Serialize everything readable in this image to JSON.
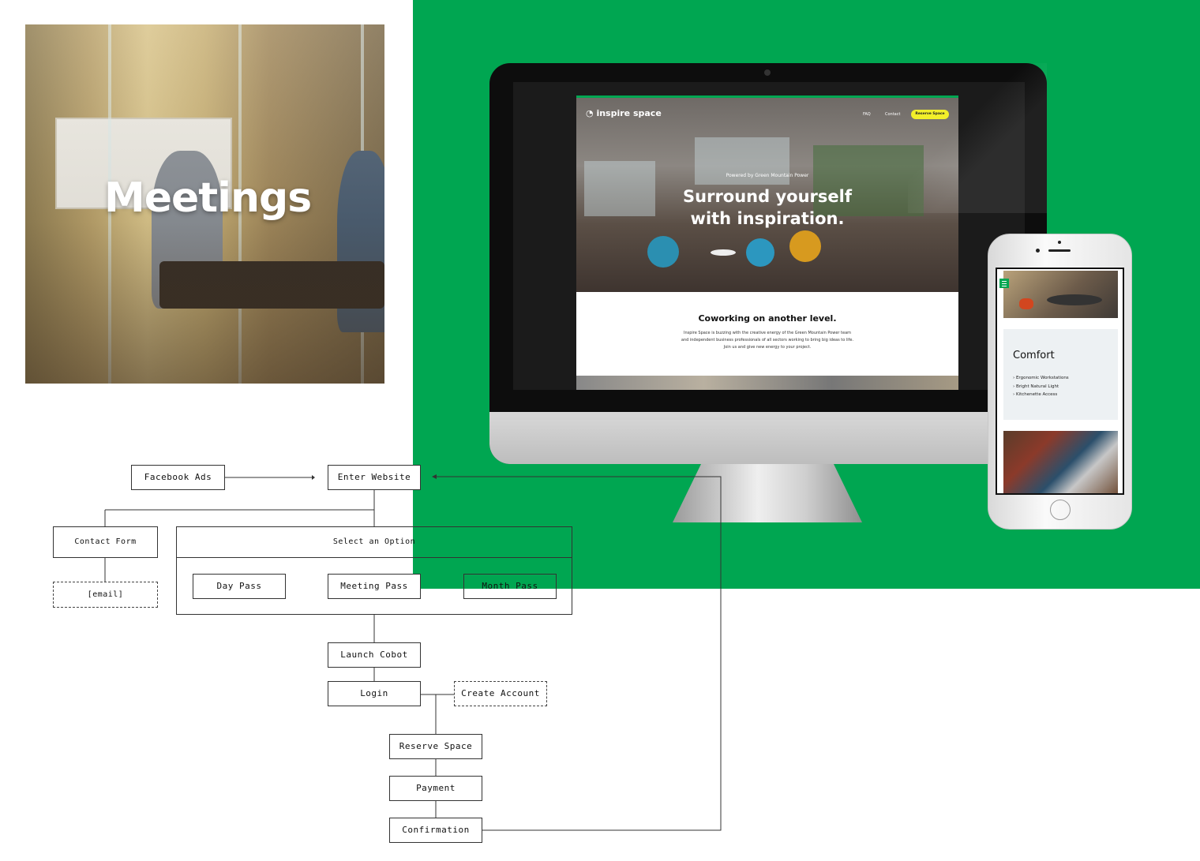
{
  "meetings_tile": {
    "title": "Meetings"
  },
  "desktop_site": {
    "logo": "inspire space",
    "nav": {
      "faq": "FAQ",
      "contact": "Contact",
      "reserve": "Reserve Space"
    },
    "powered_by": "Powered by Green Mountain Power",
    "headline_line1": "Surround yourself",
    "headline_line2": "with inspiration.",
    "section_title": "Coworking on another level.",
    "section_body": "Inspire Space is buzzing with the creative energy of the Green Mountain Power team and independent business professionals of all sectors working to bring big ideas to life. Join us and give new energy to your project."
  },
  "mobile_site": {
    "card_title": "Comfort",
    "features": [
      "› Ergonomic Workstations",
      "› Bright Natural Light",
      "› Kitchenette Access"
    ]
  },
  "flowchart": {
    "facebook_ads": "Facebook Ads",
    "enter_website": "Enter Website",
    "contact_form": "Contact Form",
    "email": "[email]",
    "select_option": "Select an Option",
    "day_pass": "Day Pass",
    "meeting_pass": "Meeting Pass",
    "month_pass": "Month Pass",
    "launch_cobot": "Launch Cobot",
    "login": "Login",
    "create_account": "Create Account",
    "reserve_space": "Reserve Space",
    "payment": "Payment",
    "confirmation": "Confirmation"
  },
  "colors": {
    "brand_green": "#00a651",
    "reserve_yellow": "#f2ef2a"
  }
}
